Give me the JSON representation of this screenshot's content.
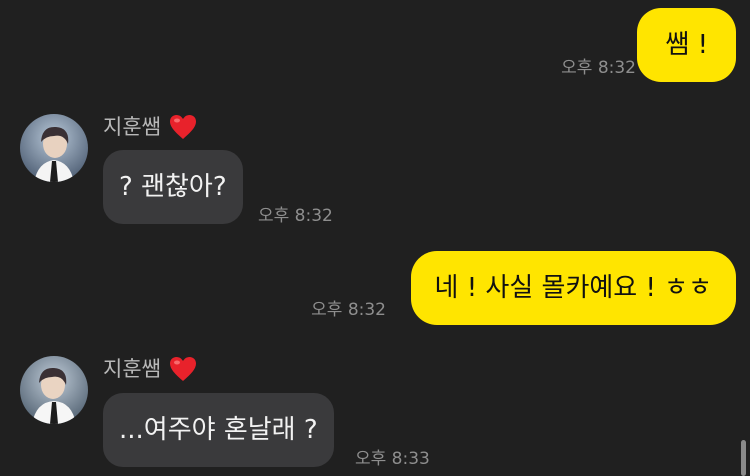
{
  "chat": {
    "partner": {
      "name": "지훈쌤",
      "badge_icon": "heart-icon"
    },
    "messages": [
      {
        "from": "me",
        "text": "쌤 !",
        "time": "오후 8:32"
      },
      {
        "from": "partner",
        "text": "? 괜찮아?",
        "time": "오후 8:32"
      },
      {
        "from": "me",
        "text": "네 ! 사실 몰카예요 ! ㅎㅎ",
        "time": "오후 8:32"
      },
      {
        "from": "partner",
        "text": "...여주야 혼날래 ?",
        "time": "오후 8:33"
      }
    ]
  },
  "colors": {
    "background": "#202020",
    "my_bubble": "#ffe500",
    "partner_bubble": "#3a3a3c",
    "heart": "#e8222b"
  }
}
